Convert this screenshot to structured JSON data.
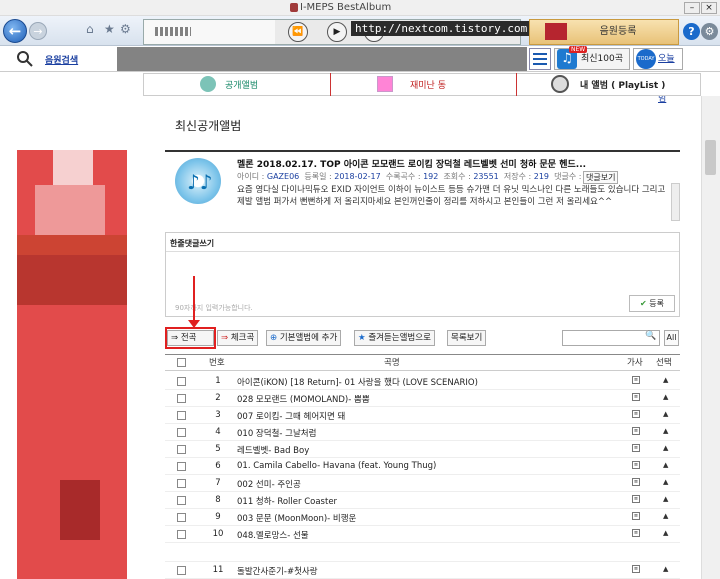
{
  "window": {
    "title": "I-MEPS BestAlbum"
  },
  "toolbar": {
    "url": "http://nextcom.tistory.com",
    "register_label": "음원등록",
    "prev_symbol": "⏪",
    "play_symbol": "▶",
    "next_symbol": "⏩"
  },
  "row2": {
    "search_link": "음원검색",
    "top100_label": "최신100곡",
    "new_tag": "NEW",
    "today_label": "오늘의앨범",
    "today_badge": "TODAY"
  },
  "nav": {
    "public": "공개앨범",
    "recent": "재미난 동",
    "my": "내 앨범 ( PlayList )"
  },
  "page_title": "최신공개앨범",
  "album": {
    "title": "멜론 2018.02.17. TOP 아이콘 모모랜드 로이킴 장덕철 레드벨벳 선미 청하 문문 헨드...",
    "meta_id_label": "아이디",
    "meta_id": "GAZE06",
    "meta_date_label": "등록일",
    "meta_date": "2018-02-17",
    "meta_count_label": "수록곡수",
    "meta_count": "192",
    "meta_views_label": "조회수",
    "meta_views": "23551",
    "meta_saves_label": "저장수",
    "meta_saves": "219",
    "meta_comments_label": "댓글수",
    "meta_comments": "0",
    "comment_view_btn": "댓글보기",
    "description": "요즘 영다실 다이나믹듀오 EXID 자이언트 이하이 뉴이스트 등등 슈가맨 더 유닛 믹스나인 다른 노래들도 있습니다 그리고 제발 앨범 퍼가서 뻔뻔하게 저 올리지마세요 본인꺼인줄이 정리를 저하시고 본인들이 그런 저 올리세요^^"
  },
  "comment": {
    "title": "한줄댓글쓰기",
    "placeholder": "90자까지 입력가능합니다.",
    "submit": "등록"
  },
  "actions": {
    "all": "전곡",
    "check": "체크곡",
    "add_default": "기본앨범에 추가",
    "add_fav": "즐겨듣는앨범으로",
    "list_view": "목록보기",
    "all_short": "All"
  },
  "table": {
    "headers": {
      "num": "번호",
      "song": "곡명",
      "lyrics": "가사",
      "select": "선택"
    },
    "rows": [
      {
        "num": "1",
        "song": "아이콘(iKON) [18 Return]- 01 사랑을 했다 (LOVE SCENARIO)"
      },
      {
        "num": "2",
        "song": "028 모모랜드 (MOMOLAND)- 뿜뿜"
      },
      {
        "num": "3",
        "song": "007 로이킴- 그때 헤어지면 돼"
      },
      {
        "num": "4",
        "song": "010 장덕철- 그날처럼"
      },
      {
        "num": "5",
        "song": "레드벨벳- Bad Boy"
      },
      {
        "num": "6",
        "song": "01. Camila Cabello- Havana (feat. Young Thug)"
      },
      {
        "num": "7",
        "song": "002 선미- 주인공"
      },
      {
        "num": "8",
        "song": "011 청하- Roller Coaster"
      },
      {
        "num": "9",
        "song": "003 문문 (MoonMoon)- 비행운"
      },
      {
        "num": "10",
        "song": "048.멜로망스- 선물"
      },
      {
        "num": "11",
        "song": "돌발간사준기-#첫사랑"
      }
    ]
  }
}
